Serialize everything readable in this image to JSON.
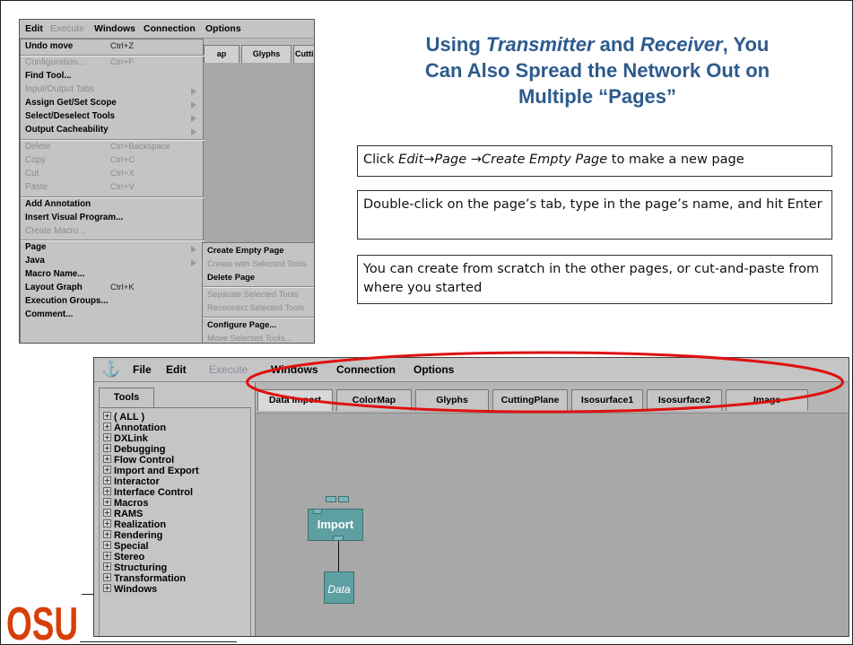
{
  "title": {
    "line1_a": "Using ",
    "line1_b": "Transmitter",
    "line1_c": " and ",
    "line1_d": "Receiver",
    "line1_e": ", You",
    "line2": "Can Also Spread the Network Out on",
    "line3": "Multiple “Pages”"
  },
  "instructions": {
    "box1": {
      "a": "Click ",
      "b": "Edit→Page →Create Empty Page",
      "c": " to make a new page"
    },
    "box2": "Double-click on the page’s tab, type in the page’s name, and hit Enter",
    "box3": "You can create from scratch in the other pages, or cut-and-paste from where you started"
  },
  "menu_shot": {
    "menubar": {
      "edit": "Edit",
      "execute": "Execute",
      "windows": "Windows",
      "connection": "Connection",
      "options": "Options"
    },
    "bg_tabs": [
      "ap",
      "Glyphs",
      "Cuttin"
    ],
    "items": [
      {
        "label": "Undo move",
        "accel": "Ctrl+Z",
        "enabled": true
      },
      {
        "label": "Configuration...",
        "accel": "Ctrl+F",
        "enabled": false
      },
      {
        "label": "Find Tool...",
        "accel": "",
        "enabled": true
      },
      {
        "label": "Input/Output Tabs",
        "accel": "",
        "enabled": false
      },
      {
        "label": "Assign Get/Set Scope",
        "accel": "",
        "enabled": true
      },
      {
        "label": "Select/Deselect Tools",
        "accel": "",
        "enabled": true
      },
      {
        "label": "Output Cacheability",
        "accel": "",
        "enabled": true
      },
      {
        "label": "Delete",
        "accel": "Ctrl+Backspace",
        "enabled": false
      },
      {
        "label": "Copy",
        "accel": "Ctrl+C",
        "enabled": false
      },
      {
        "label": "Cut",
        "accel": "Ctrl+X",
        "enabled": false
      },
      {
        "label": "Paste",
        "accel": "Ctrl+V",
        "enabled": false
      },
      {
        "label": "Add Annotation",
        "accel": "",
        "enabled": true
      },
      {
        "label": "Insert Visual Program...",
        "accel": "",
        "enabled": true
      },
      {
        "label": "Create Macro...",
        "accel": "",
        "enabled": false
      },
      {
        "label": "Page",
        "accel": "",
        "enabled": true
      },
      {
        "label": "Java",
        "accel": "",
        "enabled": true
      },
      {
        "label": "Macro Name...",
        "accel": "",
        "enabled": true
      },
      {
        "label": "Layout Graph",
        "accel": "Ctrl+K",
        "enabled": true
      },
      {
        "label": "Execution Groups...",
        "accel": "",
        "enabled": true
      },
      {
        "label": "Comment...",
        "accel": "",
        "enabled": true
      }
    ],
    "submenu": [
      {
        "label": "Create Empty Page",
        "enabled": true
      },
      {
        "label": "Create with Selected Tools",
        "enabled": false
      },
      {
        "label": "Delete Page",
        "enabled": true
      },
      {
        "label": "Separate Selected Tools",
        "enabled": false
      },
      {
        "label": "Reconnect Selected Tools",
        "enabled": false
      },
      {
        "label": "Configure Page...",
        "enabled": true
      },
      {
        "label": "Move Selected Tools...",
        "enabled": false
      }
    ]
  },
  "dx_window": {
    "menubar": {
      "file": "File",
      "edit": "Edit",
      "execute": "Execute",
      "windows": "Windows",
      "connection": "Connection",
      "options": "Options"
    },
    "tools_tab": "Tools",
    "tool_categories": [
      "( ALL )",
      "Annotation",
      "DXLink",
      "Debugging",
      "Flow Control",
      "Import and Export",
      "Interactor",
      "Interface Control",
      "Macros",
      "RAMS",
      "Realization",
      "Rendering",
      "Special",
      "Stereo",
      "Structuring",
      "Transformation",
      "Windows"
    ],
    "page_tabs": [
      "Data Import",
      "ColorMap",
      "Glyphs",
      "CuttingPlane",
      "Isosurface1",
      "Isosurface2",
      "Image"
    ],
    "nodes": {
      "import": "Import",
      "data": "Data"
    }
  },
  "colors": {
    "title": "#2d5b8d",
    "highlight": "#e01010",
    "node": "#5e9fa2",
    "osu": "#d73f09"
  },
  "logo": {
    "text": "OSU"
  }
}
